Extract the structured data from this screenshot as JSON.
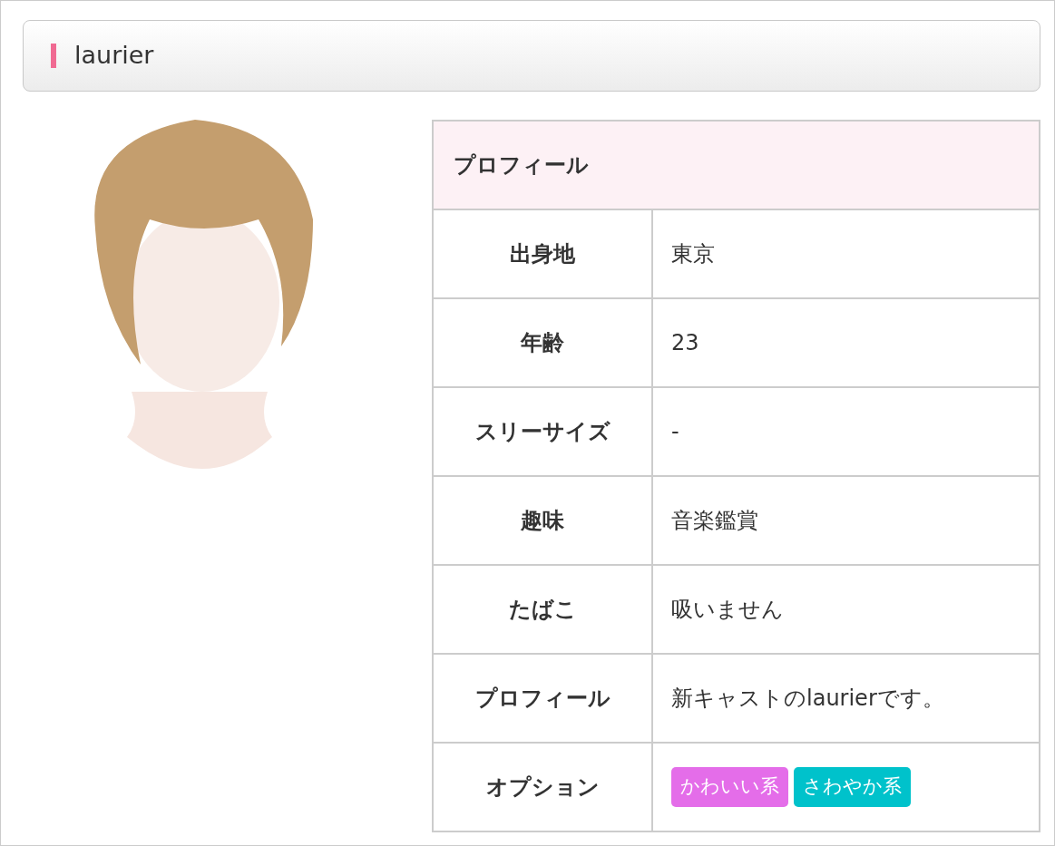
{
  "title": "laurier",
  "profile": {
    "heading": "プロフィール",
    "rows": [
      {
        "kind": "text",
        "label": "出身地",
        "value": "東京"
      },
      {
        "kind": "text",
        "label": "年齢",
        "value": "23"
      },
      {
        "kind": "text",
        "label": "スリーサイズ",
        "value": "-"
      },
      {
        "kind": "text",
        "label": "趣味",
        "value": "音楽鑑賞"
      },
      {
        "kind": "text",
        "label": "たばこ",
        "value": "吸いません"
      },
      {
        "kind": "text",
        "label": "プロフィール",
        "value": "新キャストのlaurierです。"
      },
      {
        "kind": "tags",
        "label": "オプション",
        "tags": [
          {
            "label": "かわいい系",
            "color": "#e46de9"
          },
          {
            "label": "さわやか系",
            "color": "#00c2cb"
          }
        ]
      }
    ]
  }
}
